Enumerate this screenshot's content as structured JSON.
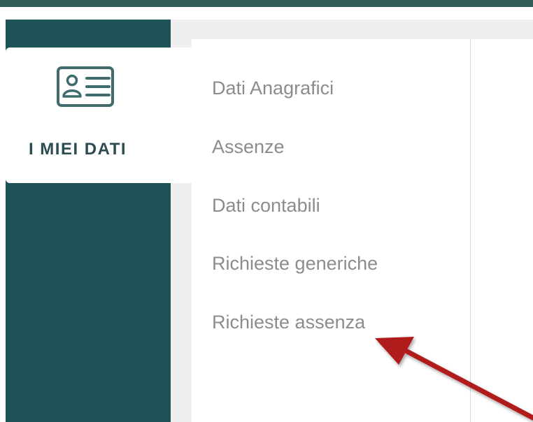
{
  "colors": {
    "sidebar_bg": "#1d5357",
    "accent_dark": "#2b4d52",
    "menu_text": "#8c8c8c",
    "annotation_arrow": "#b01e1e"
  },
  "sidebar": {
    "active_item": {
      "icon": "id-card-icon",
      "label": "I MIEI DATI"
    }
  },
  "submenu": {
    "items": [
      {
        "label": "Dati Anagrafici"
      },
      {
        "label": "Assenze"
      },
      {
        "label": "Dati contabili"
      },
      {
        "label": "Richieste generiche"
      },
      {
        "label": "Richieste assenza"
      }
    ]
  },
  "annotation": {
    "icon": "red-arrow-icon",
    "points_to": "Richieste assenza"
  }
}
